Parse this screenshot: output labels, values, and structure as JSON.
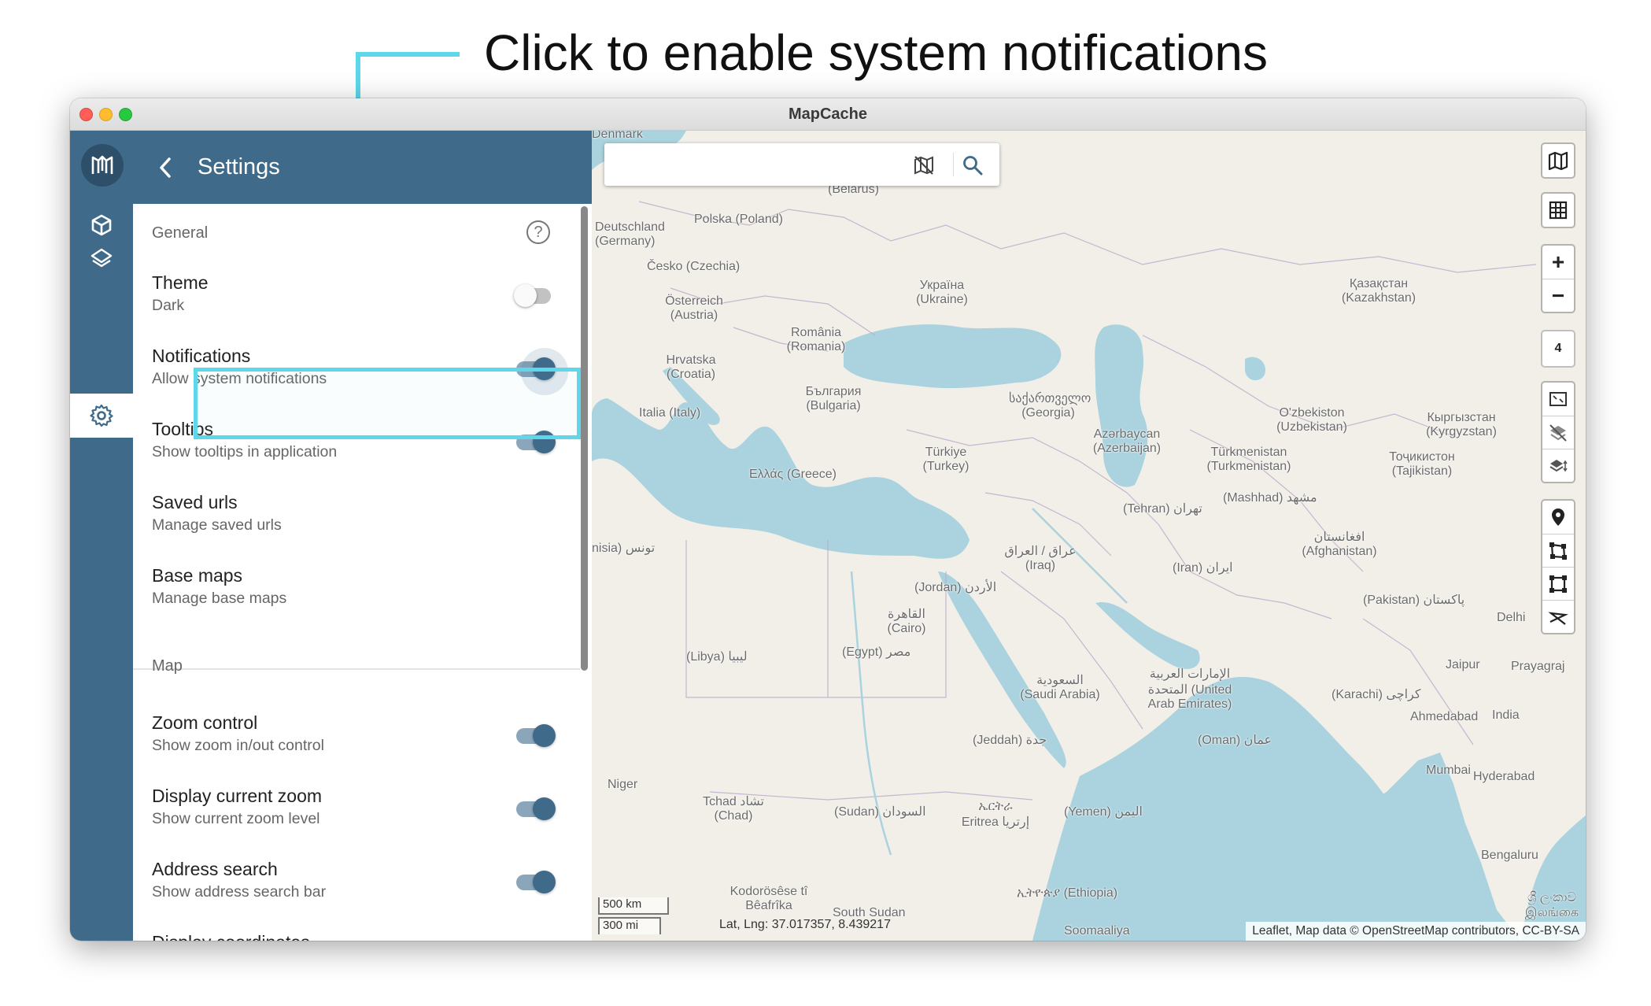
{
  "callout": {
    "text": "Click to enable system notifications"
  },
  "window": {
    "title": "MapCache"
  },
  "sidebar": {
    "items": [
      {
        "name": "geopackage-icon"
      },
      {
        "name": "layers-icon"
      },
      {
        "name": "settings-icon",
        "active": true
      }
    ]
  },
  "settings": {
    "title": "Settings",
    "general_label": "General",
    "map_label": "Map",
    "rows": [
      {
        "title": "Theme",
        "subtitle": "Dark",
        "toggle": false
      },
      {
        "title": "Notifications",
        "subtitle": "Allow system notifications",
        "toggle": true
      },
      {
        "title": "Tooltips",
        "subtitle": "Show tooltips in application",
        "toggle": true
      },
      {
        "title": "Saved urls",
        "subtitle": "Manage saved urls"
      },
      {
        "title": "Base maps",
        "subtitle": "Manage base maps"
      },
      {
        "title": "Zoom control",
        "subtitle": "Show zoom in/out control",
        "toggle": true
      },
      {
        "title": "Display current zoom",
        "subtitle": "Show current zoom level",
        "toggle": true
      },
      {
        "title": "Address search",
        "subtitle": "Show address search bar",
        "toggle": true
      },
      {
        "title": "Display coordinates",
        "toggle": true
      }
    ]
  },
  "map": {
    "search": {
      "value": "",
      "placeholder": ""
    },
    "zoom_level": "4",
    "zoom_in": "+",
    "zoom_out": "−",
    "scale_km": "500 km",
    "scale_mi": "300 mi",
    "coords": "Lat, Lng: 37.017357, 8.439217",
    "attribution": "Leaflet, Map data © OpenStreetMap contributors, CC-BY-SA",
    "labels": [
      "Denmark",
      "(Belarus)",
      "Deutschland (Germany)",
      "Polska (Poland)",
      "Česko (Czechia)",
      "Österreich (Austria)",
      "Україна (Ukraine)",
      "Қазақстан (Kazakhstan)",
      "România (Romania)",
      "Hrvatska (Croatia)",
      "България (Bulgaria)",
      "Italia (Italy)",
      "საქართველო (Georgia)",
      "Azərbaycan (Azerbaijan)",
      "O'zbekiston (Uzbekistan)",
      "Кыргызстан (Kyrgyzstan)",
      "Ελλάς (Greece)",
      "Türkiye (Turkey)",
      "Türkmenistan (Turkmenistan)",
      "Тоҷикистон (Tajikistan)",
      "(Tehran) تهران",
      "(Mashhad) مشهد",
      "افغانستان (Afghanistan)",
      "nisia) تونس",
      "عراق / العراق (Iraq)",
      "(Iran) ایران",
      "(Jordan) الأردن",
      "القاهرة (Cairo)",
      "(Pakistan) پاکستان",
      "Delhi",
      "(Libya) ليبيا",
      "(Egypt) مصر",
      "السعودية (Saudi Arabia)",
      "الإمارات العربية المتحدة (United Arab Emirates)",
      "(Karachi) کراچی",
      "Jaipur",
      "Prayagraj",
      "Ahmedabad",
      "India",
      "(Jeddah) جدة",
      "(Oman) عمان",
      "Mumbai",
      "Hyderabad",
      "Niger",
      "Tchad تشاد (Chad)",
      "(Sudan) السودان",
      "ኤርትራ Eritrea إرتريا",
      "(Yemen) اليمن",
      "Bengaluru",
      "Kodorösêse tî Bêafrîka",
      "South Sudan",
      "ኢትዮጵያ (Ethiopia)",
      "Soomaaliya",
      "ශ්‍රී ලංකාව இலங்கை"
    ]
  }
}
